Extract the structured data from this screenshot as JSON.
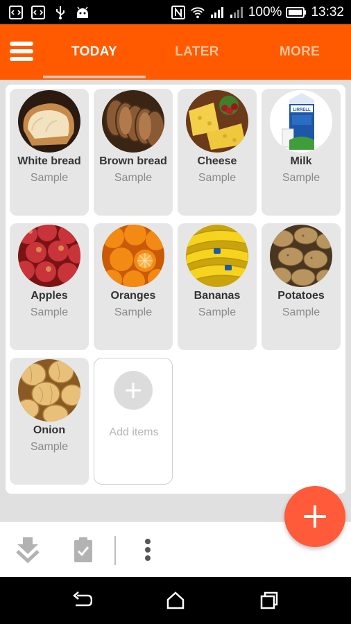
{
  "status_bar": {
    "battery": "100%",
    "time": "13:32",
    "icons": [
      "code-icon",
      "code-icon",
      "usb-icon",
      "android-icon",
      "nfc-icon",
      "wifi-icon",
      "signal-icon",
      "signal-icon",
      "battery-icon"
    ]
  },
  "app_bar": {
    "menu_icon": "hamburger-icon",
    "tabs": [
      {
        "label": "TODAY",
        "active": true
      },
      {
        "label": "LATER",
        "active": false
      },
      {
        "label": "MORE",
        "active": false
      }
    ],
    "colors": {
      "accent": "#ff5a00",
      "tab_inactive": "#ffc49b"
    }
  },
  "items": [
    {
      "name": "White bread",
      "sub": "Sample",
      "image": "white-bread-image"
    },
    {
      "name": "Brown bread",
      "sub": "Sample",
      "image": "brown-bread-image"
    },
    {
      "name": "Cheese",
      "sub": "Sample",
      "image": "cheese-image"
    },
    {
      "name": "Milk",
      "sub": "Sample",
      "image": "milk-carton-image"
    },
    {
      "name": "Apples",
      "sub": "Sample",
      "image": "apples-image"
    },
    {
      "name": "Oranges",
      "sub": "Sample",
      "image": "oranges-image"
    },
    {
      "name": "Bananas",
      "sub": "Sample",
      "image": "bananas-image"
    },
    {
      "name": "Potatoes",
      "sub": "Sample",
      "image": "potatoes-image"
    },
    {
      "name": "Onion",
      "sub": "Sample",
      "image": "onion-image"
    }
  ],
  "add_tile": {
    "label": "Add items",
    "icon": "plus-icon"
  },
  "fab": {
    "icon": "plus-icon",
    "color": "#ff5a3a"
  },
  "bottom_toolbar": {
    "buttons": [
      "download-icon",
      "clipboard-check-icon",
      "more-vert-icon"
    ]
  },
  "nav_bar": {
    "buttons": [
      "back-icon",
      "home-icon",
      "recents-icon"
    ]
  }
}
